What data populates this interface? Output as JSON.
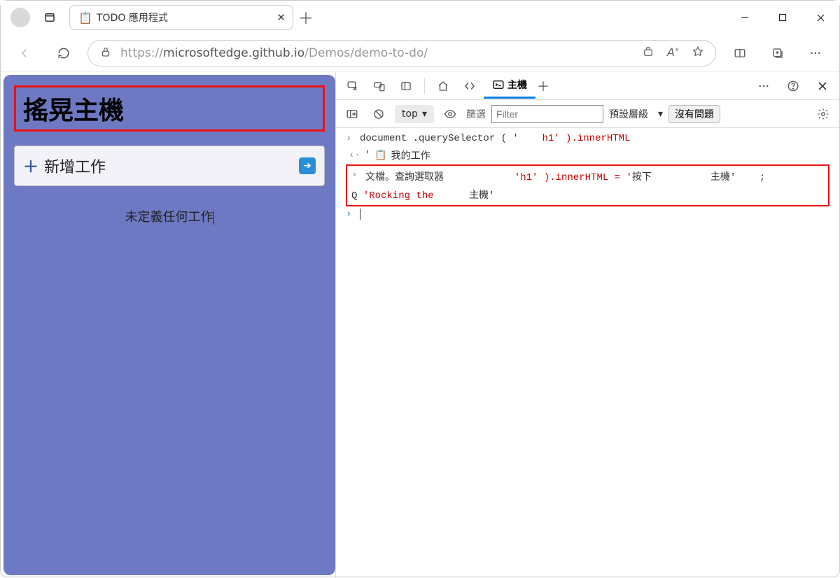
{
  "browser": {
    "tab_title": "TODO 應用程式",
    "url_proto": "https://",
    "url_host": "microsoftedge.github.io",
    "url_path": "/Demos/demo-to-do/"
  },
  "app": {
    "h1": "搖晃主機",
    "add_task": "新增工作",
    "empty": "未定義任何工作"
  },
  "devtools": {
    "console_tab": "主機",
    "top": "top",
    "filter_label": "篩選",
    "filter_placeholder": "Filter",
    "levels": "預設層級",
    "issues": "沒有問題",
    "lines": {
      "l1a": "document .querySelector ( '",
      "l1b": "h1' ).innerHTML",
      "l2_icon": "📋",
      "l2": "我的工作",
      "l3a": "文檔。查詢選取器",
      "l3b": "'h1' ).innerHTML = '",
      "l3c": "按下",
      "l3d": "主機'",
      "l3e": ";",
      "l4a": "Q ",
      "l4b": "'Rocking the",
      "l4c": "主機'"
    }
  }
}
